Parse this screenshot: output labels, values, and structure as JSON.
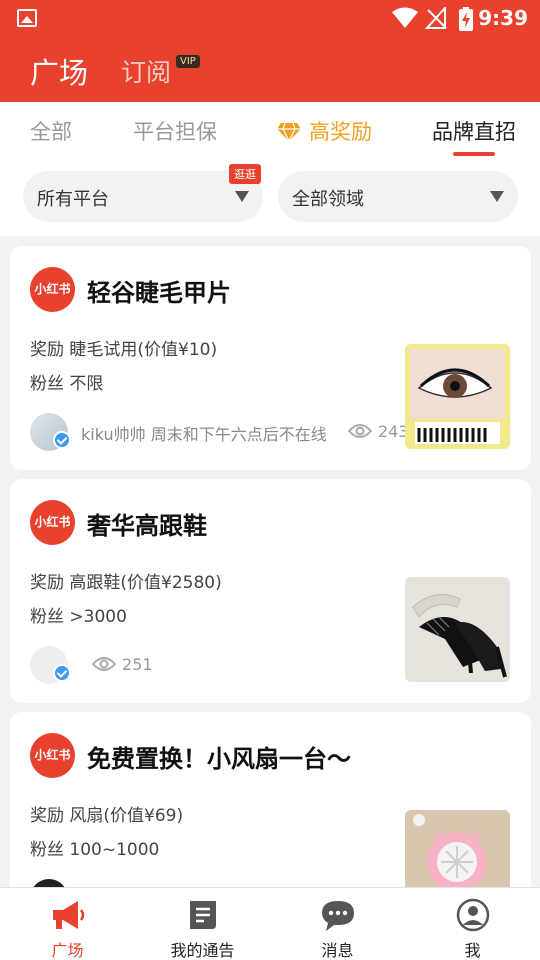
{
  "status_bar": {
    "time": "9:39"
  },
  "app_bar": {
    "title": "广场",
    "subscribe": "订阅",
    "vip": "VIP"
  },
  "tabs": [
    {
      "label": "全部"
    },
    {
      "label": "平台担保"
    },
    {
      "label": "高奖励"
    },
    {
      "label": "品牌直招"
    }
  ],
  "filters": {
    "platform": "所有平台",
    "platform_badge": "逛逛",
    "field": "全部领域"
  },
  "cards": [
    {
      "platform_logo": "小红书",
      "title": "轻谷睫毛甲片",
      "reward": "奖励 睫毛试用(价值¥10)",
      "fans": "粉丝 不限",
      "poster": "kiku帅帅 周末和下午六点后不在线",
      "views": "243"
    },
    {
      "platform_logo": "小红书",
      "title": "奢华高跟鞋",
      "reward": "奖励 高跟鞋(价值¥2580)",
      "fans": "粉丝 >3000",
      "poster": "",
      "views": "251"
    },
    {
      "platform_logo": "小红书",
      "title": "免费置换！小风扇一台～",
      "reward": "奖励 风扇(价值¥69)",
      "fans": "粉丝 100~1000",
      "poster": "",
      "views": ""
    }
  ],
  "bottom_nav": [
    {
      "label": "广场",
      "icon": "megaphone-icon"
    },
    {
      "label": "我的通告",
      "icon": "notice-doc-icon"
    },
    {
      "label": "消息",
      "icon": "chat-bubble-icon"
    },
    {
      "label": "我",
      "icon": "user-profile-icon"
    }
  ],
  "colors": {
    "brand_red": "#e8412e",
    "gold": "#f0a020",
    "verified_blue": "#3d9af0"
  }
}
